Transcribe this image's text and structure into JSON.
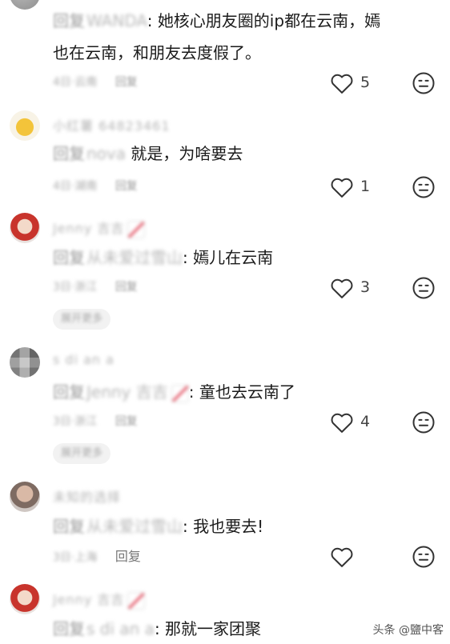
{
  "comments": [
    {
      "username": "",
      "reply_prefix": "回复",
      "reply_target": "WANDA",
      "text_line1": "她核心朋友圈的ip都在云南，嫣",
      "text_line2": "也在云南，和朋友去度假了。",
      "meta": "4日·云南",
      "meta_reply": "回复",
      "likes": "5"
    },
    {
      "username": "小红薯 64823461",
      "reply_prefix": "回复",
      "reply_target": "nova",
      "text": "就是，为啥要去",
      "meta": "4日·湖南",
      "meta_reply": "回复",
      "likes": "1"
    },
    {
      "username": "Jenny 吉吉",
      "reply_prefix": "回复",
      "reply_target": "从未爱过雪山",
      "text": "嫣儿在云南",
      "meta": "3日·浙江",
      "meta_reply": "回复",
      "likes": "3",
      "expand_label": "展开更多"
    },
    {
      "username": "s di an a",
      "reply_prefix": "回复",
      "reply_target": "Jenny 吉吉",
      "text": "童也去云南了",
      "meta": "3日·浙江",
      "meta_reply": "回复",
      "likes": "4",
      "expand_label": "展开更多"
    },
    {
      "username": "未知的选择",
      "reply_prefix": "回复",
      "reply_target": "从未爱过雪山",
      "text": "我也要去!",
      "meta": "3日·上海",
      "meta_reply": "回复",
      "likes": ""
    },
    {
      "username": "Jenny 吉吉",
      "reply_prefix": "回复",
      "reply_target": "s di an a",
      "text": "那就一家团聚",
      "likes": ""
    }
  ],
  "watermark": "头条 @鹽中客"
}
